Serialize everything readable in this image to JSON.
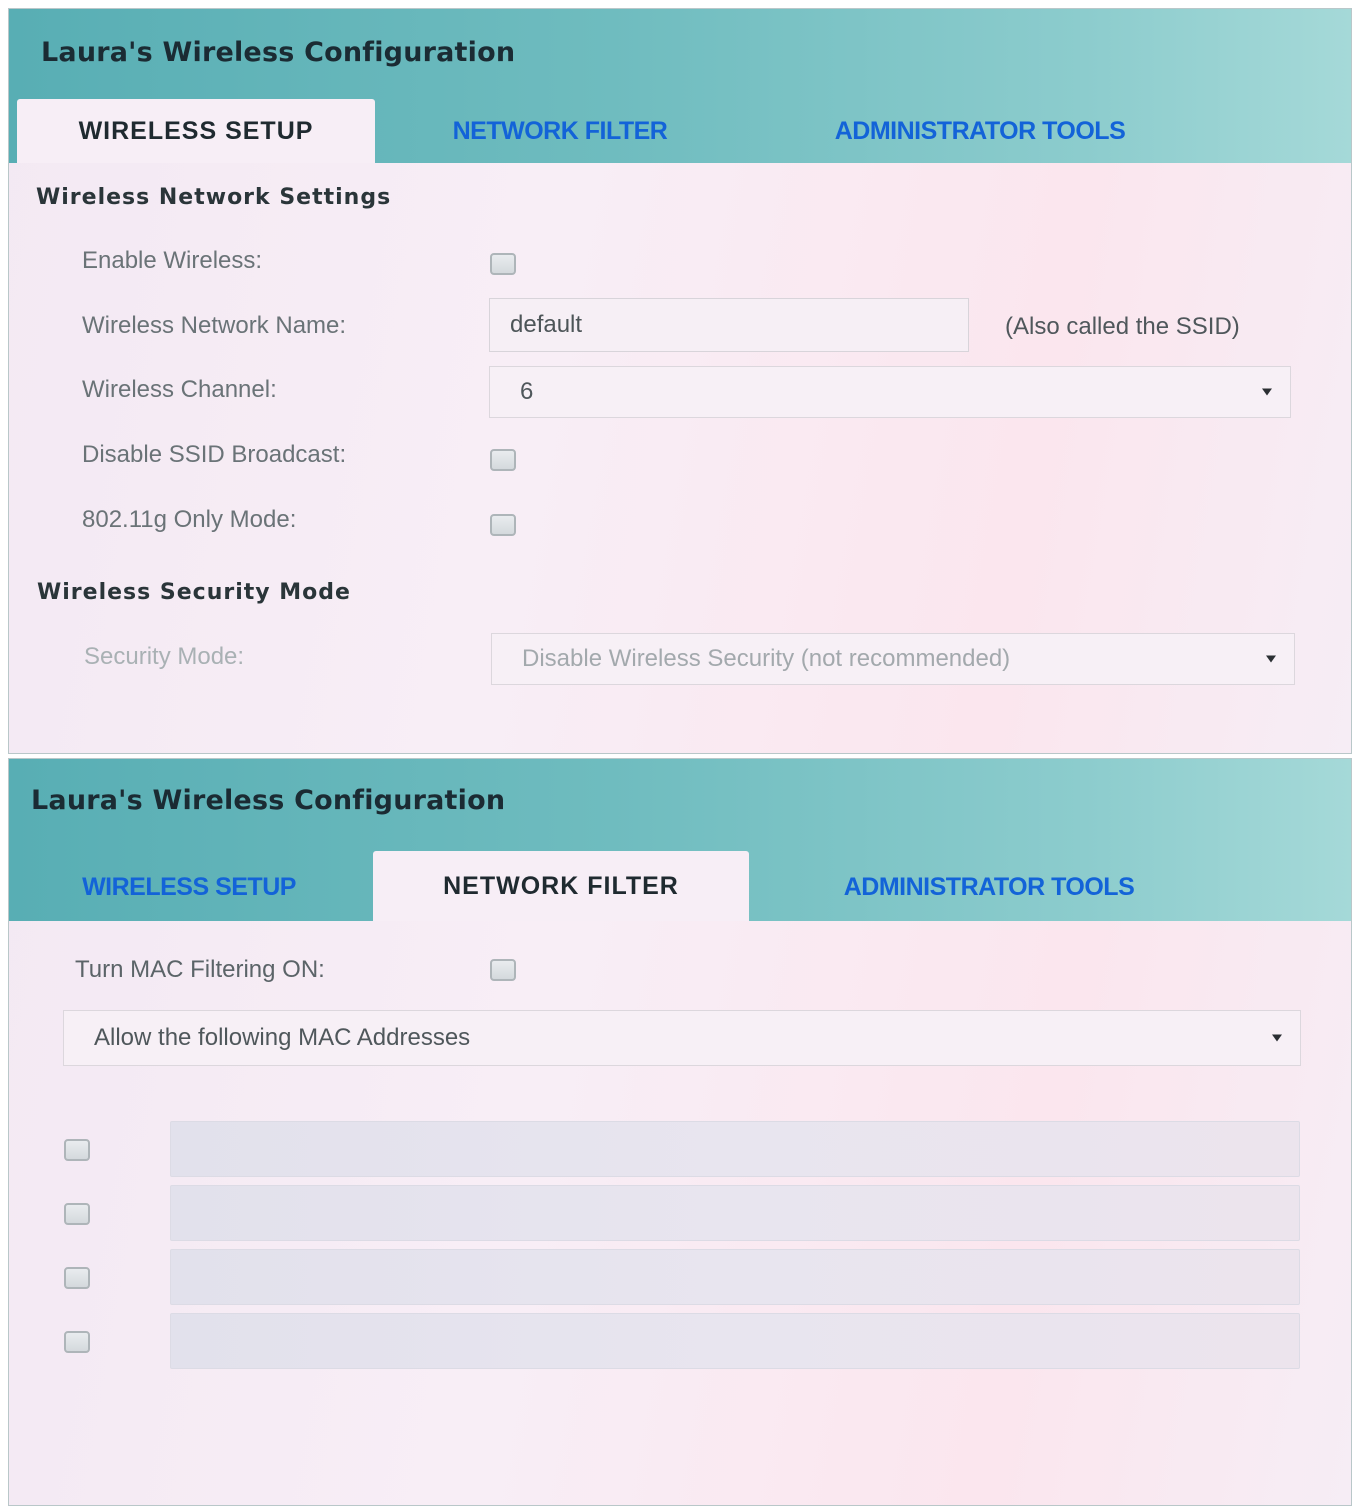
{
  "panel1": {
    "app_title": "Laura's Wireless Configuration",
    "tabs": [
      {
        "label": "WIRELESS SETUP",
        "active": true
      },
      {
        "label": "NETWORK FILTER",
        "active": false
      },
      {
        "label": "ADMINISTRATOR TOOLS",
        "active": false
      }
    ],
    "network_settings": {
      "title": "Wireless Network Settings",
      "enable_wireless_label": "Enable Wireless:",
      "enable_wireless_checked": false,
      "network_name_label": "Wireless Network Name:",
      "network_name_value": "default",
      "network_name_note": "(Also called the SSID)",
      "channel_label": "Wireless Channel:",
      "channel_value": "6",
      "disable_ssid_label": "Disable SSID Broadcast:",
      "disable_ssid_checked": false,
      "g_only_label": "802.11g Only Mode:",
      "g_only_checked": false
    },
    "security": {
      "title": "Wireless Security Mode",
      "mode_label": "Security Mode:",
      "mode_value": "Disable Wireless Security (not recommended)"
    }
  },
  "panel2": {
    "app_title": "Laura's Wireless Configuration",
    "tabs": [
      {
        "label": "WIRELESS SETUP",
        "active": false
      },
      {
        "label": "NETWORK FILTER",
        "active": true
      },
      {
        "label": "ADMINISTRATOR TOOLS",
        "active": false
      }
    ],
    "mac_filter": {
      "toggle_label": "Turn MAC Filtering ON:",
      "toggle_checked": false,
      "mode_value": "Allow the following MAC Addresses",
      "entries": [
        {
          "checked": false,
          "value": ""
        },
        {
          "checked": false,
          "value": ""
        },
        {
          "checked": false,
          "value": ""
        },
        {
          "checked": false,
          "value": ""
        }
      ]
    }
  },
  "colors": {
    "header_teal": "#6fbcbf",
    "inactive_tab_blue": "#1363d8",
    "panel_background": "#f6edf5"
  }
}
